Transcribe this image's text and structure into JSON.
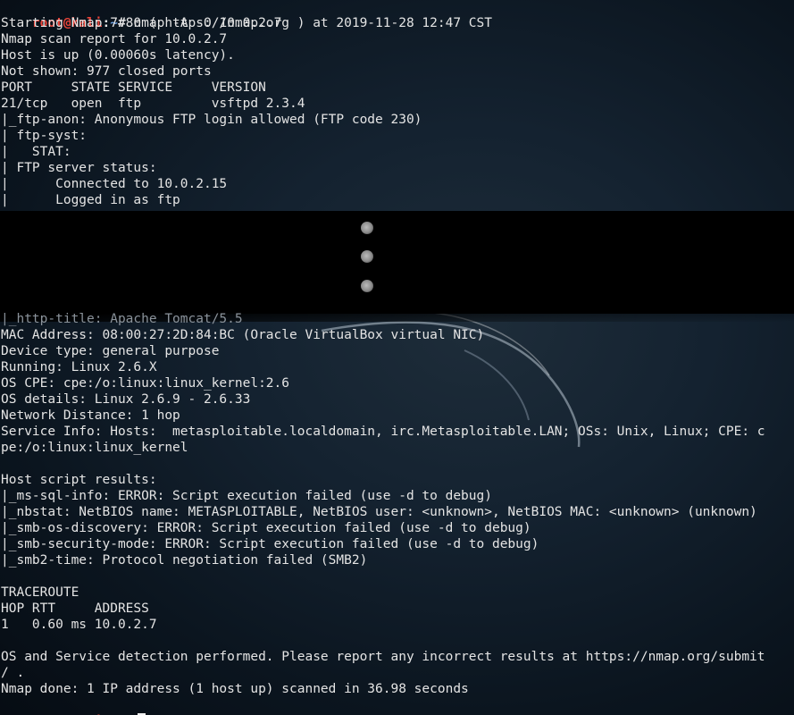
{
  "prompt": {
    "user_host": "root@kali",
    "separator": ":",
    "path": "~",
    "hash": "# "
  },
  "command": "nmap -A -O 10.0.2.7",
  "output_top": [
    "Starting Nmap 7.80 ( https://nmap.org ) at 2019-11-28 12:47 CST",
    "Nmap scan report for 10.0.2.7",
    "Host is up (0.00060s latency).",
    "Not shown: 977 closed ports",
    "PORT     STATE SERVICE     VERSION",
    "21/tcp   open  ftp         vsftpd 2.3.4",
    "|_ftp-anon: Anonymous FTP login allowed (FTP code 230)",
    "| ftp-syst:",
    "|   STAT:",
    "| FTP server status:",
    "|      Connected to 10.0.2.15",
    "|      Logged in as ftp"
  ],
  "output_faded": "|_http-title: Apache Tomcat/5.5",
  "output_bottom": [
    "MAC Address: 08:00:27:2D:84:BC (Oracle VirtualBox virtual NIC)",
    "Device type: general purpose",
    "Running: Linux 2.6.X",
    "OS CPE: cpe:/o:linux:linux_kernel:2.6",
    "OS details: Linux 2.6.9 - 2.6.33",
    "Network Distance: 1 hop",
    "Service Info: Hosts:  metasploitable.localdomain, irc.Metasploitable.LAN; OSs: Unix, Linux; CPE: c",
    "pe:/o:linux:linux_kernel",
    "",
    "Host script results:",
    "|_ms-sql-info: ERROR: Script execution failed (use -d to debug)",
    "|_nbstat: NetBIOS name: METASPLOITABLE, NetBIOS user: <unknown>, NetBIOS MAC: <unknown> (unknown)",
    "|_smb-os-discovery: ERROR: Script execution failed (use -d to debug)",
    "|_smb-security-mode: ERROR: Script execution failed (use -d to debug)",
    "|_smb2-time: Protocol negotiation failed (SMB2)",
    "",
    "TRACEROUTE",
    "HOP RTT     ADDRESS",
    "1   0.60 ms 10.0.2.7",
    "",
    "OS and Service detection performed. Please report any incorrect results at https://nmap.org/submit",
    "/ .",
    "Nmap done: 1 IP address (1 host up) scanned in 36.98 seconds"
  ],
  "colors": {
    "user_host": "#e8443a",
    "path": "#6c9fe0",
    "text": "#e4e4e4",
    "background": "#142230"
  }
}
